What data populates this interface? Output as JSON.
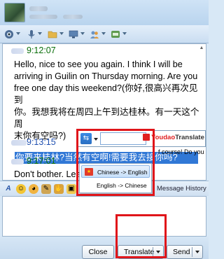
{
  "chat": {
    "messages": [
      {
        "time": "9:12:07",
        "text_lines": [
          "Hello, nice to see you again. I think I will be",
          "arriving in Guilin on Thursday morning. Are you",
          "free one day this weekend?(你好,很高兴再次见到",
          "你。我想我将在周四上午到达桂林。有一天这个周",
          "末你有空吗?)"
        ]
      },
      {
        "time": "9:13:15",
        "highlighted_text": "你要来桂林?当然有空啊!需要我去接你吗?"
      },
      {
        "time": "9:17:01",
        "text_visible": "Don't bother. Lea"
      }
    ]
  },
  "popup": {
    "brand_red": "Youdao",
    "brand_rest": "Translate",
    "translation_snippet": "f course! Do you",
    "menu": [
      {
        "label": "Chinese -> English",
        "selected": true
      },
      {
        "label": "English -> Chinese",
        "selected": false
      }
    ]
  },
  "format_toolbar": {
    "history_label": "Message History"
  },
  "buttons": {
    "close": "Close",
    "translate": "Translate",
    "send": "Send"
  },
  "colors": {
    "highlight": "#3178d6",
    "red_box": "#e0151a",
    "timestamp_green": "#0a6e0a",
    "timestamp_blue": "#1f4fb0"
  }
}
